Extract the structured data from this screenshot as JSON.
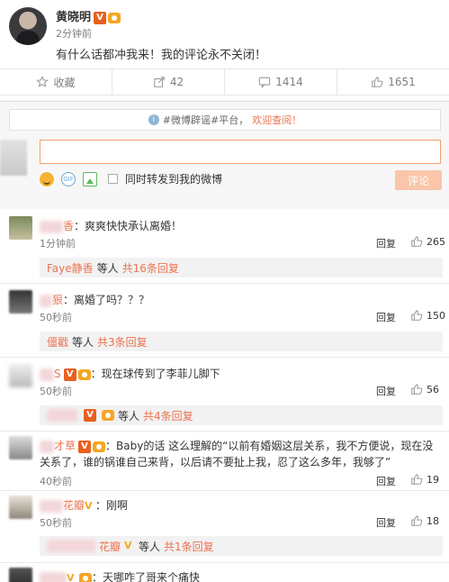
{
  "post": {
    "author": "黄晓明",
    "verified_badge": "V",
    "time": "2分钟前",
    "text": "有什么话都冲我来！我的评论永不关闭！"
  },
  "actions": {
    "favorite": "收藏",
    "forward_count": "42",
    "comment_count": "1414",
    "like_count": "1651"
  },
  "composer": {
    "notice_prefix": "#微博辟谣#平台，",
    "notice_link": "欢迎查阅！",
    "input_value": "",
    "forward_label": "同时转发到我的微博",
    "submit_label": "评论"
  },
  "comments": [
    {
      "name": "香",
      "text": "：爽爽快快承认离婚！",
      "time": "1分钟前",
      "reply_label": "回复",
      "likes": "265",
      "sub": {
        "name": "Faye静香",
        "suffix": "等人",
        "more": "共16条回复"
      }
    },
    {
      "name": "狠",
      "text": "：离婚了吗？？？",
      "time": "50秒前",
      "reply_label": "回复",
      "likes": "150",
      "sub": {
        "name": "僵戳",
        "suffix": "等人",
        "more": "共3条回复"
      }
    },
    {
      "name": "S",
      "text": "：现在球传到了李菲儿脚下",
      "time": "50秒前",
      "reply_label": "回复",
      "likes": "56",
      "sub": {
        "name": "",
        "suffix": "等人",
        "more": "共4条回复"
      }
    },
    {
      "name": "才草",
      "text": "：Baby的话 这么理解的“以前有婚姻这层关系，我不方便说，现在没关系了，谁的锅谁自己来背，以后请不要扯上我，忍了这么多年，我够了”",
      "time": "40秒前",
      "reply_label": "回复",
      "likes": "19"
    },
    {
      "name": "花瓣",
      "text": "：刚啊",
      "time": "50秒前",
      "reply_label": "回复",
      "likes": "18",
      "sub": {
        "name": "花瓣",
        "suffix": "等人",
        "more": "共1条回复"
      }
    },
    {
      "name": "",
      "text": "：天哪咋了哥来个痛快"
    }
  ],
  "colors": {
    "accent": "#eb7350",
    "badge_orange": "#e8601f",
    "gold": "#f5a623"
  }
}
